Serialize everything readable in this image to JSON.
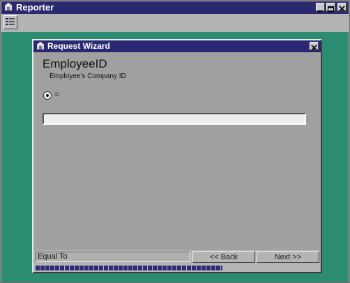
{
  "window": {
    "title": "Reporter",
    "min_icon": "minimize-icon",
    "max_icon": "maximize-icon",
    "close_icon": "close-icon"
  },
  "toolbar": {
    "tool_icon": "report-list-icon"
  },
  "colors": {
    "title_bar": "#2b2a6e",
    "workspace": "#2c8c72",
    "progress": "#2d2b7a"
  },
  "dialog": {
    "title": "Request Wizard",
    "field_name": "EmployeeID",
    "field_description": "Employee's Company ID",
    "operator_label": "=",
    "operator_selected": true,
    "value": "",
    "status_text": "Equal To",
    "back_label": "<< Back",
    "next_label": "Next >>",
    "progress": 0.66
  }
}
